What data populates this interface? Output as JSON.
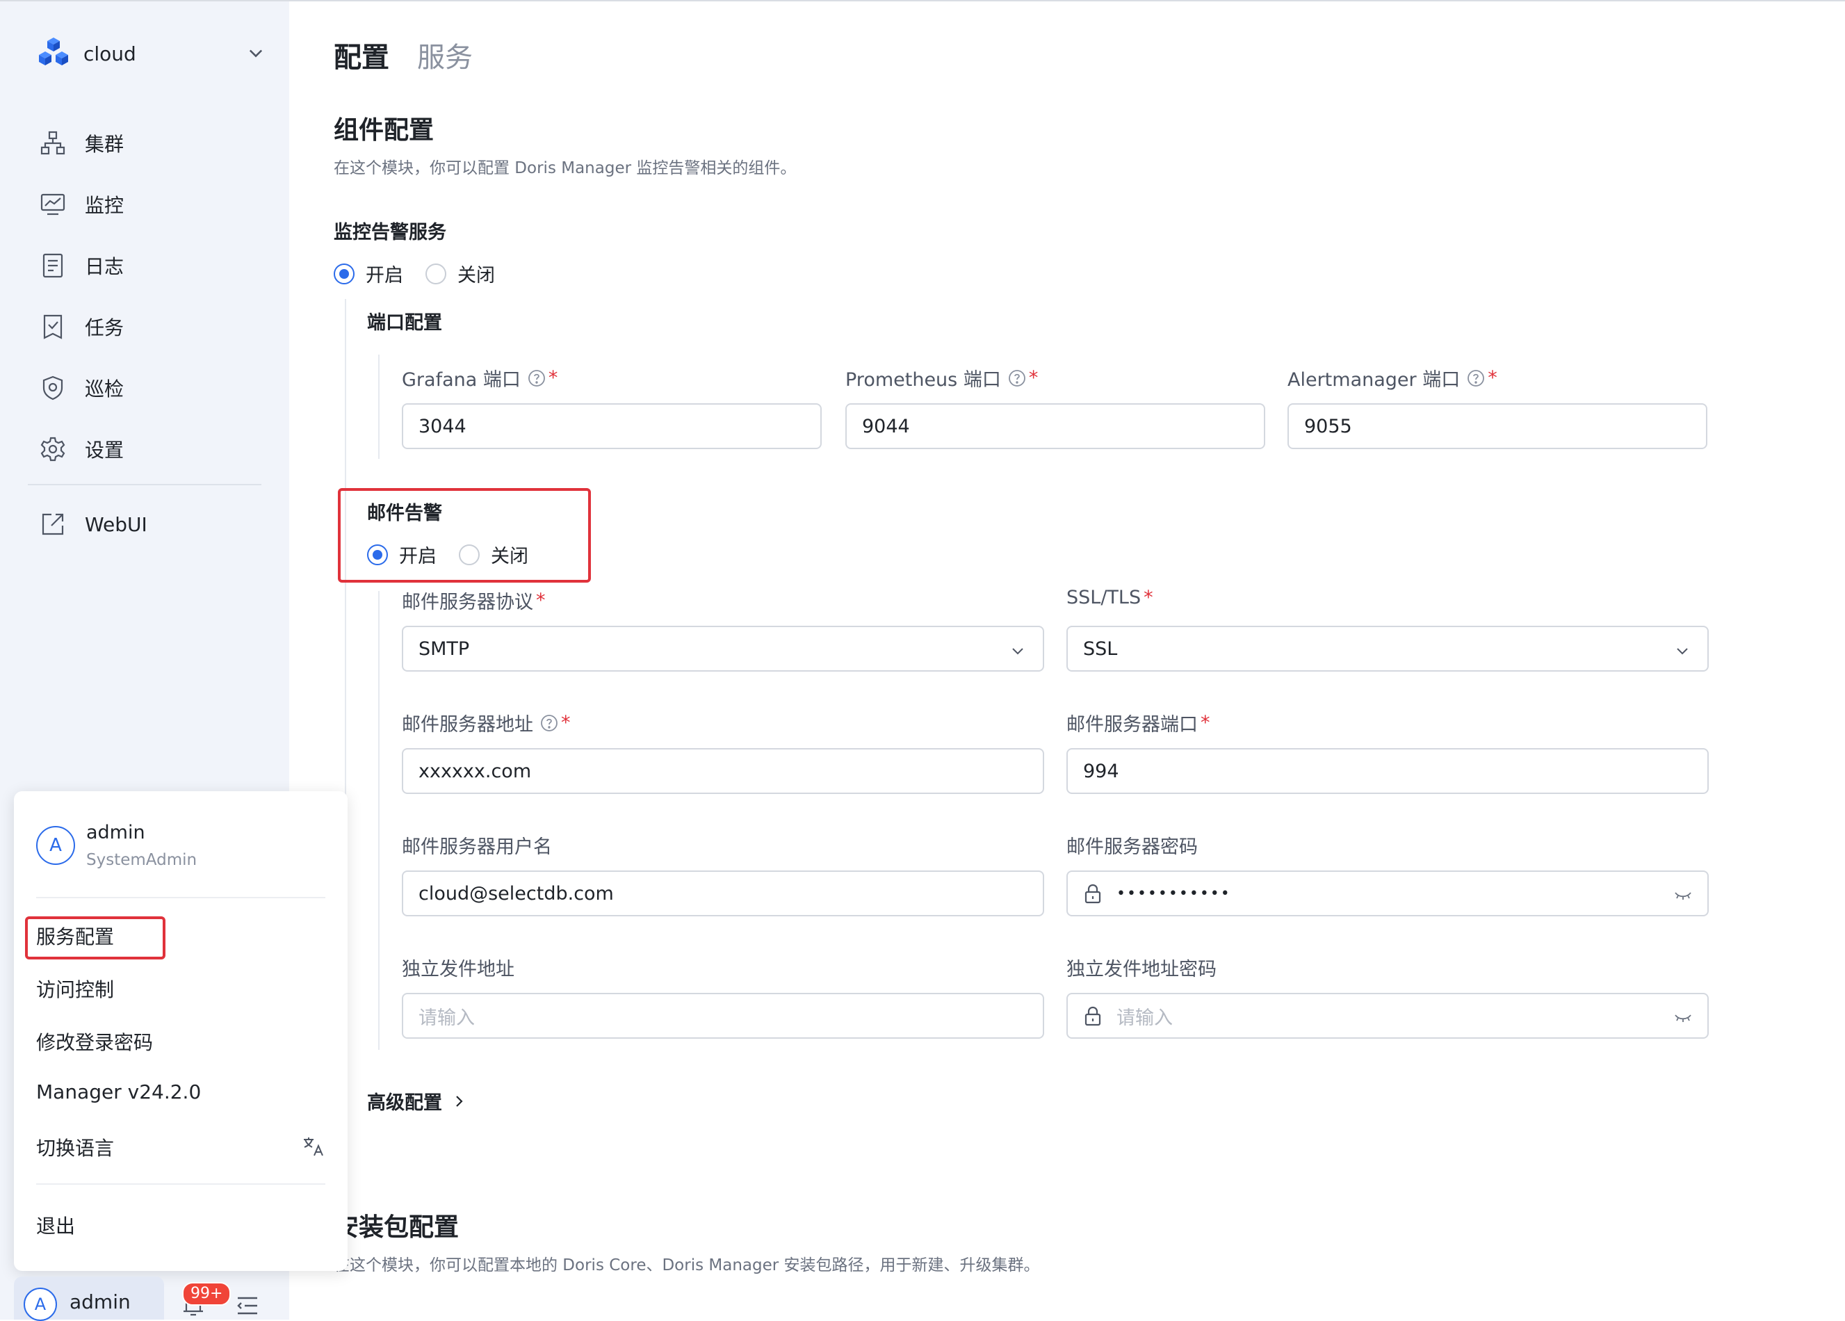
{
  "brand": {
    "name": "cloud"
  },
  "sidebar": {
    "items": [
      {
        "label": "集群",
        "icon": "cluster-icon"
      },
      {
        "label": "监控",
        "icon": "monitor-icon"
      },
      {
        "label": "日志",
        "icon": "log-icon"
      },
      {
        "label": "任务",
        "icon": "task-icon"
      },
      {
        "label": "巡检",
        "icon": "inspection-icon"
      },
      {
        "label": "设置",
        "icon": "gear-icon"
      }
    ],
    "webui": {
      "label": "WebUI",
      "icon": "external-link-icon"
    }
  },
  "user_menu": {
    "avatar_letter": "A",
    "name": "admin",
    "role": "SystemAdmin",
    "items": [
      "服务配置",
      "访问控制",
      "修改登录密码",
      "Manager v24.2.0",
      "切换语言"
    ],
    "logout": "退出"
  },
  "bottom_bar": {
    "avatar_letter": "A",
    "name": "admin",
    "badge": "99+"
  },
  "tabs": [
    {
      "label": "配置",
      "active": true
    },
    {
      "label": "服务",
      "active": false
    }
  ],
  "component_config": {
    "title": "组件配置",
    "description": "在这个模块，你可以配置 Doris Manager 监控告警相关的组件。",
    "monitor_service": {
      "label": "监控告警服务",
      "on_label": "开启",
      "off_label": "关闭",
      "selected": "开启"
    },
    "port_config": {
      "title": "端口配置",
      "grafana": {
        "label": "Grafana 端口",
        "value": "3044"
      },
      "prometheus": {
        "label": "Prometheus 端口",
        "value": "9044"
      },
      "alertmanager": {
        "label": "Alertmanager 端口",
        "value": "9055"
      }
    },
    "email_alert": {
      "title": "邮件告警",
      "on_label": "开启",
      "off_label": "关闭",
      "selected": "开启",
      "protocol": {
        "label": "邮件服务器协议",
        "value": "SMTP"
      },
      "ssl": {
        "label": "SSL/TLS",
        "value": "SSL"
      },
      "server_address": {
        "label": "邮件服务器地址",
        "value": "xxxxxx.com"
      },
      "server_port": {
        "label": "邮件服务器端口",
        "value": "994"
      },
      "username": {
        "label": "邮件服务器用户名",
        "value": "cloud@selectdb.com"
      },
      "password": {
        "label": "邮件服务器密码",
        "value": "•••••••••••"
      },
      "independent_sender": {
        "label": "独立发件地址",
        "placeholder": "请输入"
      },
      "independent_sender_password": {
        "label": "独立发件地址密码",
        "placeholder": "请输入"
      }
    },
    "advanced": {
      "label": "高级配置"
    }
  },
  "package_config": {
    "title": "安装包配置",
    "description": "在这个模块，你可以配置本地的 Doris Core、Doris Manager 安装包路径，用于新建、升级集群。"
  },
  "colors": {
    "accent": "#2b6bea",
    "highlight": "#e0323b",
    "sidebar_bg": "#f1f4fa"
  }
}
